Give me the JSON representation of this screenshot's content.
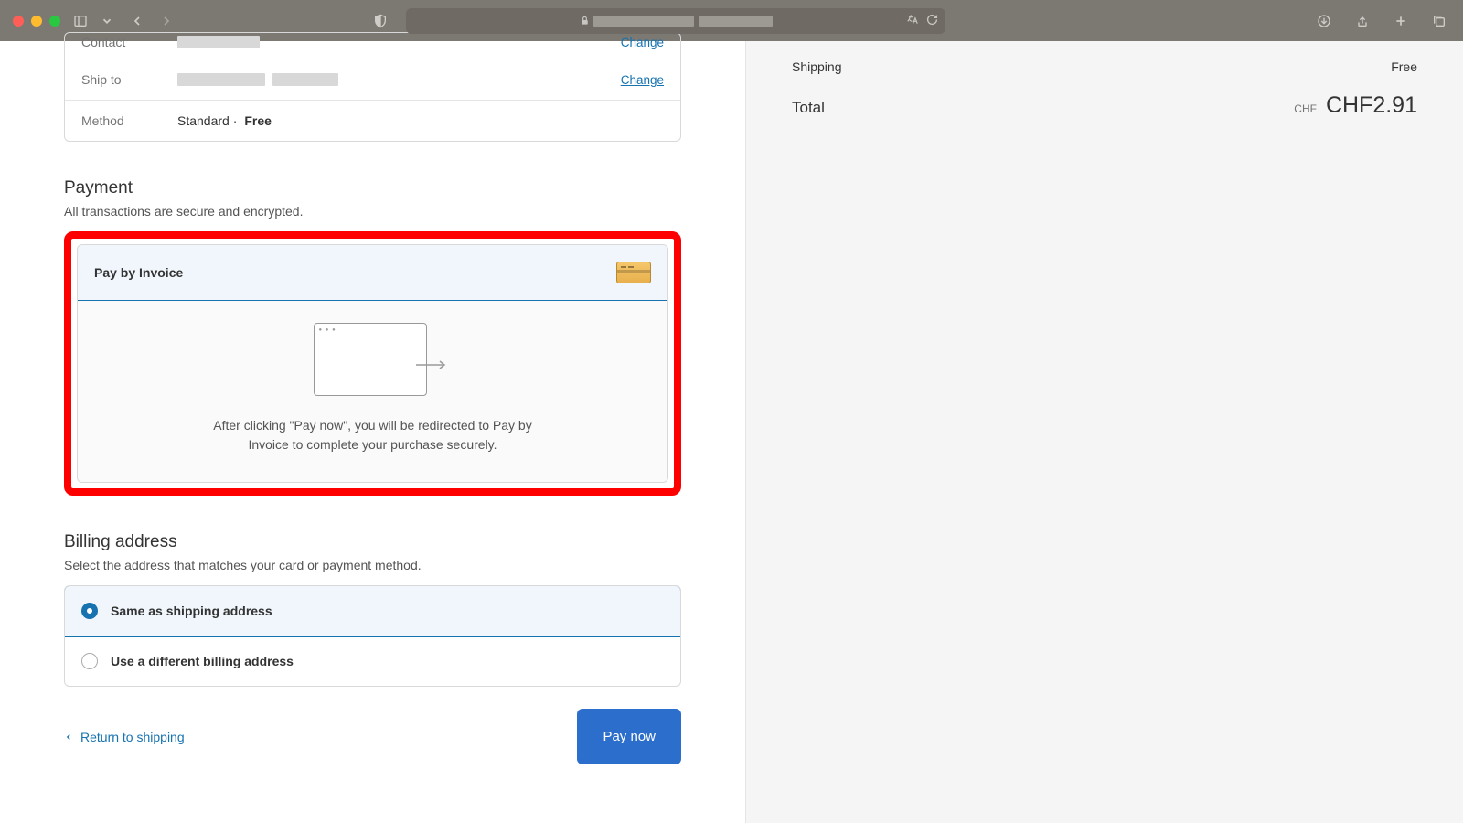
{
  "review": {
    "contact_label": "Contact",
    "contact_change": "Change",
    "ship_label": "Ship to",
    "ship_change": "Change",
    "method_label": "Method",
    "method_value_prefix": "Standard · ",
    "method_value_bold": "Free"
  },
  "payment": {
    "heading": "Payment",
    "subtext": "All transactions are secure and encrypted.",
    "method_title": "Pay by Invoice",
    "description": "After clicking \"Pay now\", you will be redirected to Pay by Invoice to complete your purchase securely."
  },
  "billing": {
    "heading": "Billing address",
    "subtext": "Select the address that matches your card or payment method.",
    "option_same": "Same as shipping address",
    "option_different": "Use a different billing address"
  },
  "nav": {
    "return": "Return to shipping",
    "pay_now": "Pay now"
  },
  "summary": {
    "shipping_label": "Shipping",
    "shipping_value": "Free",
    "total_label": "Total",
    "total_currency": "CHF",
    "total_amount": "CHF2.91"
  }
}
